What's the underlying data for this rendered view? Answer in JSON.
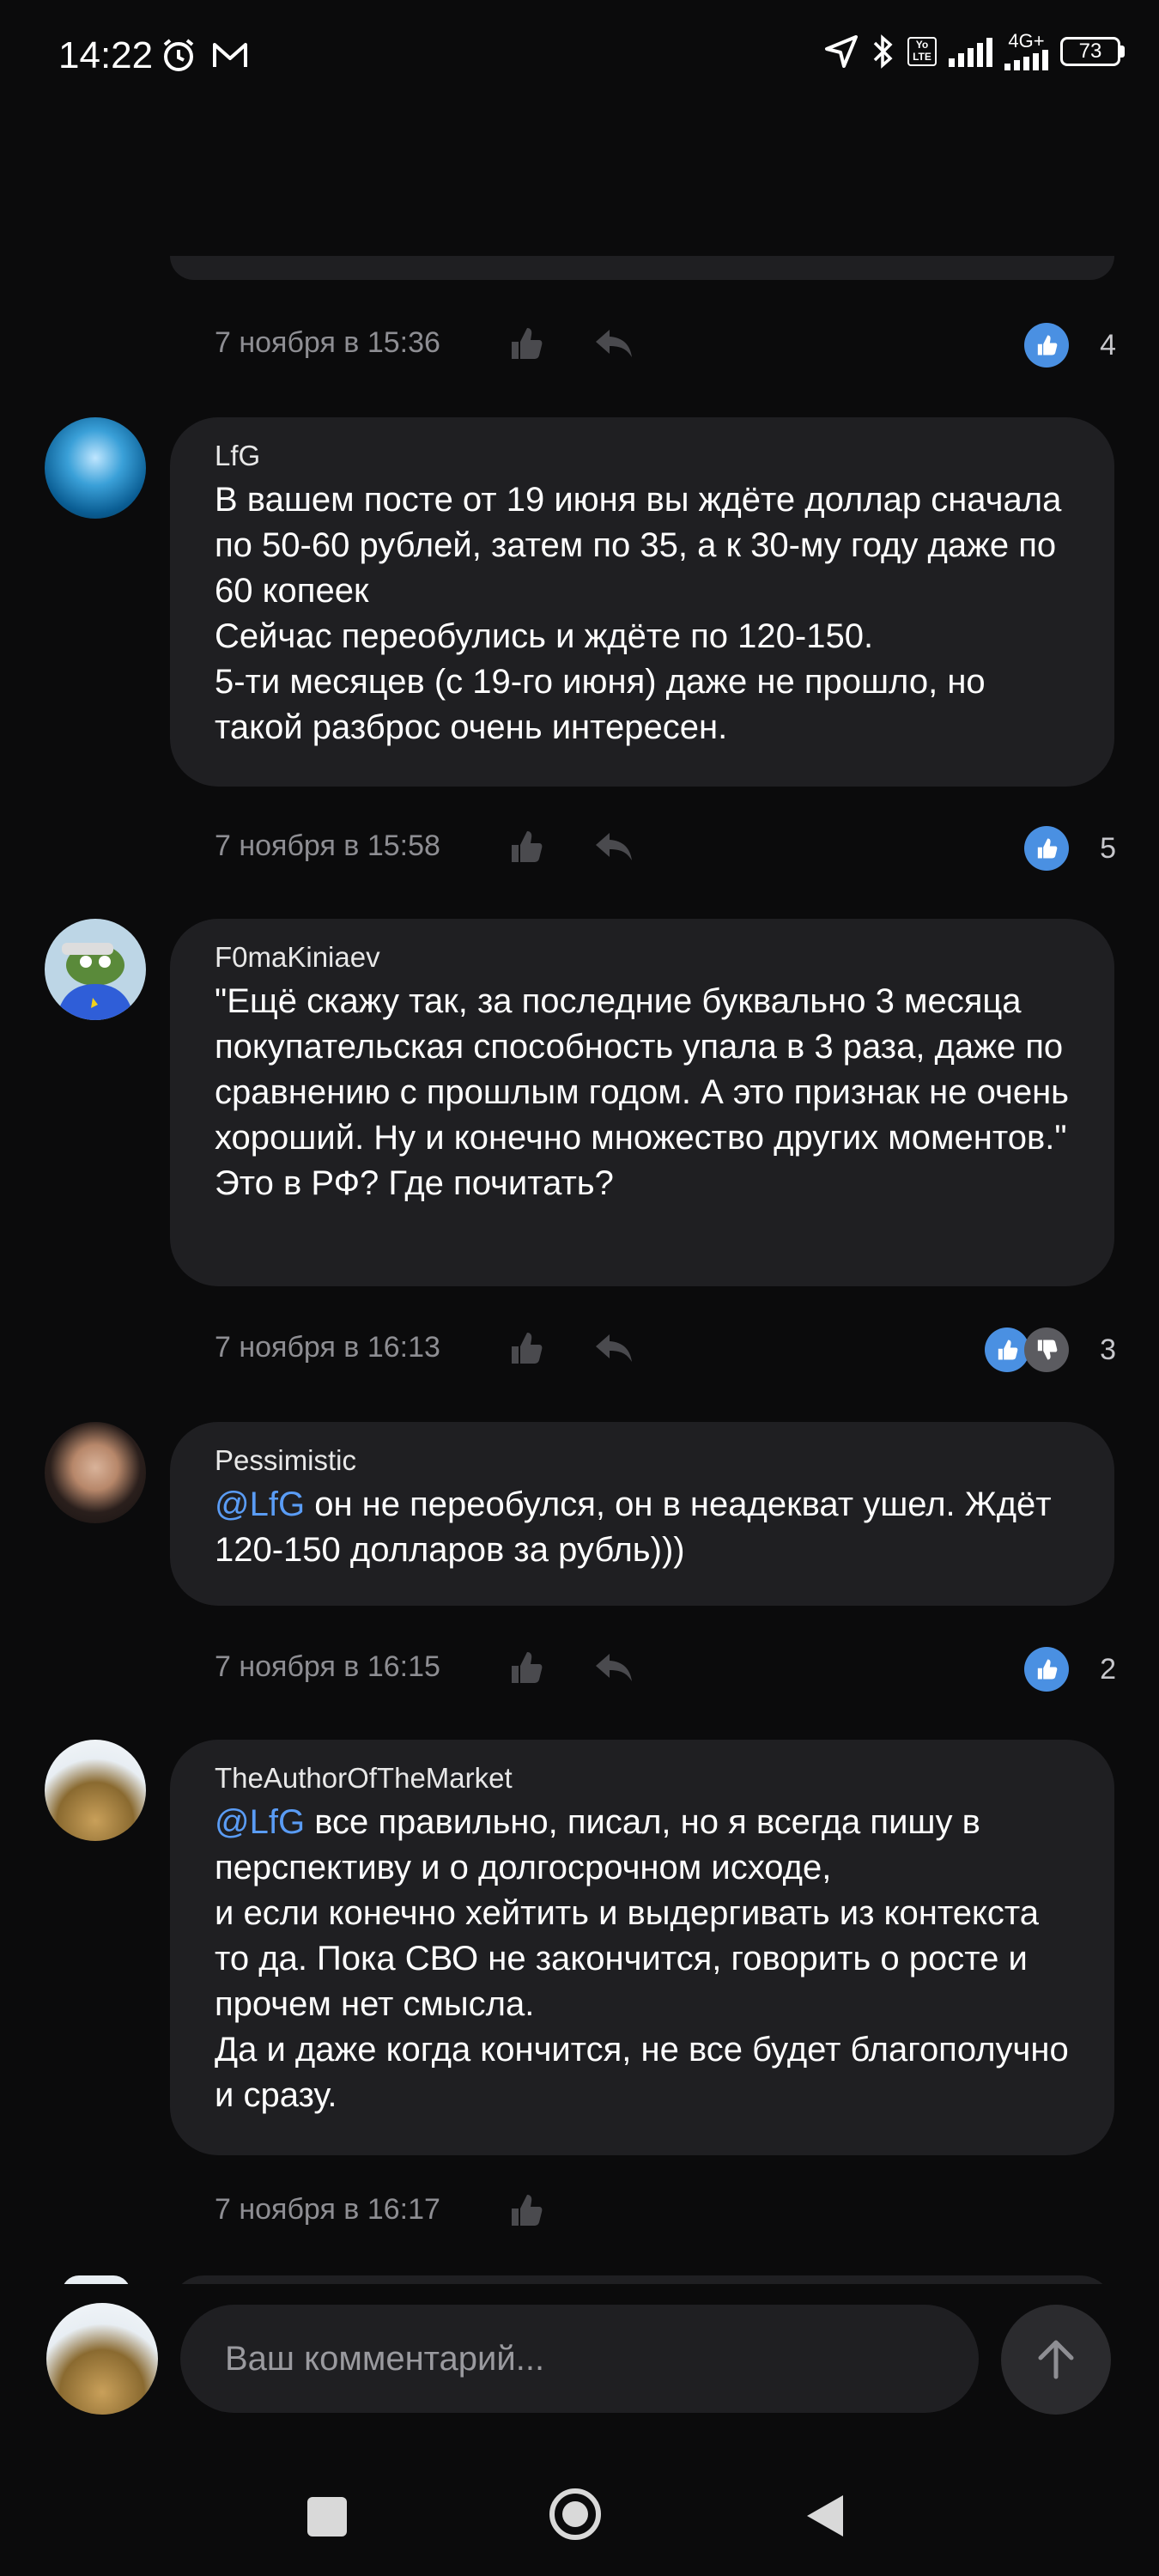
{
  "status": {
    "time": "14:22",
    "network": "4G+",
    "lte_badge": "Yo LTE",
    "battery": "73"
  },
  "header": {
    "back_icon": "arrow-left-icon",
    "bookmark_icon": "bookmark-icon",
    "share_icon": "share-icon"
  },
  "comments": [
    {
      "date": "7 ноября в 15:36",
      "likes": "4",
      "reactions": [
        "like"
      ]
    },
    {
      "author": "LfG",
      "mention": "",
      "text": "В вашем посте от 19 июня вы ждёте доллар сначала по 50-60 рублей, затем по 35, а к 30-му году даже по 60 копеек\nСейчас переобулись и ждёте по 120-150.\n5-ти месяцев (с 19-го июня) даже не прошло, но такой разброс очень интересен.",
      "date": "7 ноября в 15:58",
      "likes": "5",
      "reactions": [
        "like"
      ]
    },
    {
      "author": "F0maKiniaev",
      "mention": "",
      "text": "\"Ещё скажу так, за последние буквально 3 месяца покупательская способность упала в 3 раза, даже по сравнению с прошлым годом. А это признак не очень хороший. Ну и конечно множество других моментов.\" Это в РФ? Где почитать?",
      "date": "7 ноября в 16:13",
      "likes": "3",
      "reactions": [
        "like",
        "dislike"
      ]
    },
    {
      "author": "Pessimistic",
      "mention": "@LfG",
      "text": " он не переобулся, он в неадекват ушел. Ждёт 120-150 долларов за рубль)))",
      "date": "7 ноября в 16:15",
      "likes": "2",
      "reactions": [
        "like"
      ]
    },
    {
      "author": "TheAuthorOfTheMarket",
      "mention": "@LfG",
      "text": " все правильно, писал, но я всегда пишу в перспективу и о долгосрочном исходе,\nи если конечно хейтить и выдергивать из контекста то да. Пока СВО не закончится, говорить о росте и прочем нет смысла.\nДа и даже когда кончится, не все будет благополучно и сразу.",
      "date": "7 ноября в 16:17",
      "likes": "",
      "reactions": []
    }
  ],
  "composer": {
    "placeholder": "Ваш комментарий..."
  },
  "colors": {
    "background": "#0b0b0c",
    "bubble": "#1f1f22",
    "accent": "#4a90e2",
    "mention": "#5a9cf5",
    "muted": "#8e8e93"
  }
}
